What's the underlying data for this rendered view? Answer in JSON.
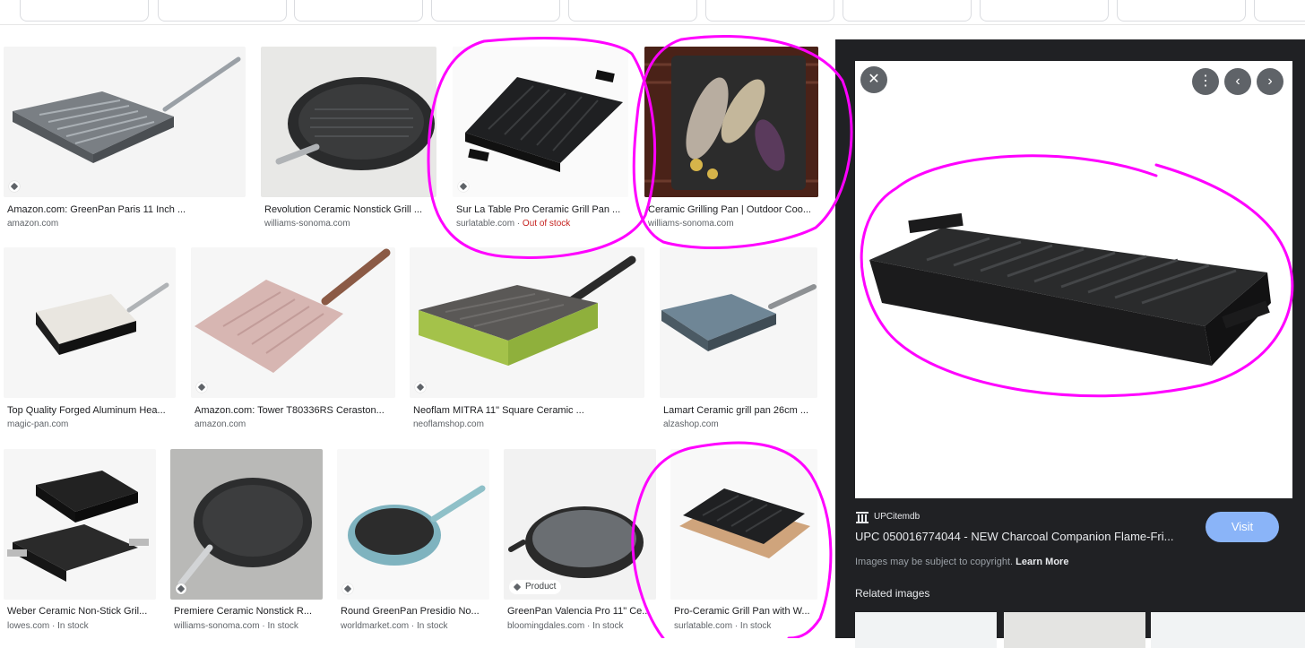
{
  "results": [
    {
      "title": "Amazon.com: GreenPan Paris 11 Inch ...",
      "source": "amazon.com",
      "stock": "",
      "product_badge": ""
    },
    {
      "title": "Revolution Ceramic Nonstick Grill ...",
      "source": "williams-sonoma.com",
      "stock": "",
      "product_badge": ""
    },
    {
      "title": "Sur La Table Pro Ceramic Grill Pan ...",
      "source": "surlatable.com",
      "stock": "Out of stock",
      "product_badge": ""
    },
    {
      "title": "Ceramic Grilling Pan | Outdoor Coo...",
      "source": "williams-sonoma.com",
      "stock": "",
      "product_badge": ""
    },
    {
      "title": "Top Quality Forged Aluminum Hea...",
      "source": "magic-pan.com",
      "stock": "",
      "product_badge": ""
    },
    {
      "title": "Amazon.com: Tower T80336RS Ceraston...",
      "source": "amazon.com",
      "stock": "",
      "product_badge": ""
    },
    {
      "title": "Neoflam MITRA 11\" Square Ceramic ...",
      "source": "neoflamshop.com",
      "stock": "",
      "product_badge": ""
    },
    {
      "title": "Lamart Ceramic grill pan 26cm ...",
      "source": "alzashop.com",
      "stock": "",
      "product_badge": ""
    },
    {
      "title": "Weber Ceramic Non-Stick Gril...",
      "source": "lowes.com",
      "stock": "In stock",
      "product_badge": ""
    },
    {
      "title": "Premiere Ceramic Nonstick R...",
      "source": "williams-sonoma.com",
      "stock": "In stock",
      "product_badge": ""
    },
    {
      "title": "Round GreenPan Presidio No...",
      "source": "worldmarket.com",
      "stock": "In stock",
      "product_badge": ""
    },
    {
      "title": "GreenPan Valencia Pro 11\" Ce...",
      "source": "bloomingdales.com",
      "stock": "In stock",
      "product_badge": "Product"
    },
    {
      "title": "Pro-Ceramic Grill Pan with W...",
      "source": "surlatable.com",
      "stock": "In stock",
      "product_badge": ""
    }
  ],
  "panel": {
    "source_logo": "UPC",
    "source_name": "UPCitemdb",
    "title": "UPC 050016774044 - NEW Charcoal Companion Flame-Fri...",
    "visit_label": "Visit",
    "copyright_text": "Images may be subject to copyright.",
    "learn_more": "Learn More",
    "related_heading": "Related images",
    "close_glyph": "✕",
    "more_glyph": "⋮",
    "prev_glyph": "‹",
    "next_glyph": "›"
  },
  "sep": " · ",
  "colors": {
    "annotation": "#ff00ff",
    "panel_bg": "#202124",
    "visit": "#8ab4f8",
    "out_of_stock": "#c5221f"
  }
}
